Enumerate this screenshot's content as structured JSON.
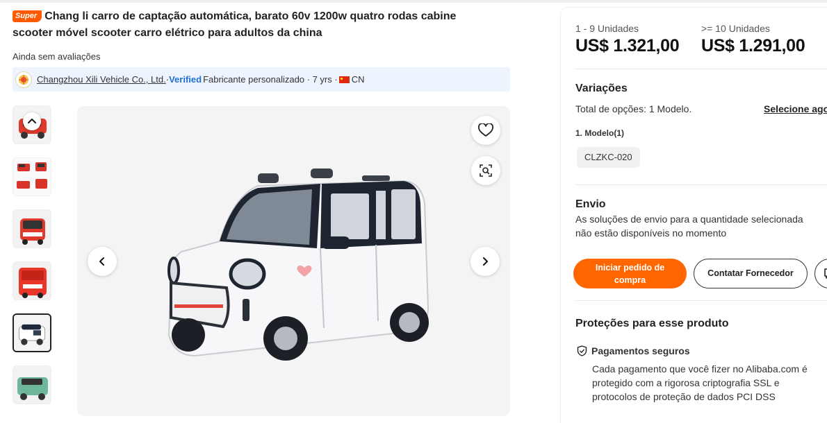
{
  "product": {
    "badge": "Super",
    "title": "Chang li carro de captação automática, barato 60v 1200w quatro rodas cabine scooter móvel scooter carro elétrico para adultos da china",
    "reviews": "Ainda sem avaliações"
  },
  "supplier": {
    "name": "Changzhou Xili Vehicle Co., Ltd.",
    "sep1": " · ",
    "verified_v": "V",
    "verified_rest": "erified",
    "type": " Fabricante personalizado · 7 yrs · ",
    "country": "CN"
  },
  "thumbnails": [
    {
      "name": "thumb-1"
    },
    {
      "name": "thumb-2"
    },
    {
      "name": "thumb-3"
    },
    {
      "name": "thumb-4"
    },
    {
      "name": "thumb-5",
      "selected": true
    },
    {
      "name": "thumb-6"
    }
  ],
  "pricing": {
    "tiers": [
      {
        "qty": "1 - 9 Unidades",
        "price": "US$ 1.321,00"
      },
      {
        "qty": ">= 10 Unidades",
        "price": "US$ 1.291,00"
      }
    ]
  },
  "variations": {
    "title": "Variações",
    "total": "Total de opções: 1 Modelo.",
    "select_link": "Selecione agora",
    "model_label": "1. Modelo(1)",
    "model_option": "CLZKC-020"
  },
  "shipping": {
    "title": "Envio",
    "line1": "As soluções de envio para a quantidade selecionada",
    "line2": "não estão disponíveis no momento"
  },
  "actions": {
    "order_button": "Iniciar pedido de compra",
    "contact_button": "Contatar Fornecedor"
  },
  "protections": {
    "title": "Proteções para esse produto",
    "payment_title": "Pagamentos seguros",
    "payment_line1": "Cada pagamento que você fizer no Alibaba.com é",
    "payment_line2": "protegido com a rigorosa criptografia SSL e",
    "payment_line3": "protocolos de proteção de dados PCI DSS"
  },
  "colors": {
    "accent": "#ff6600",
    "verified_blue": "#1f6fd9",
    "supplier_bg": "#eef4fd"
  },
  "icons": [
    "heart-icon",
    "image-search-icon",
    "chevron-left-icon",
    "chevron-right-icon",
    "chevron-up-icon",
    "shield-check-icon",
    "chat-icon"
  ]
}
